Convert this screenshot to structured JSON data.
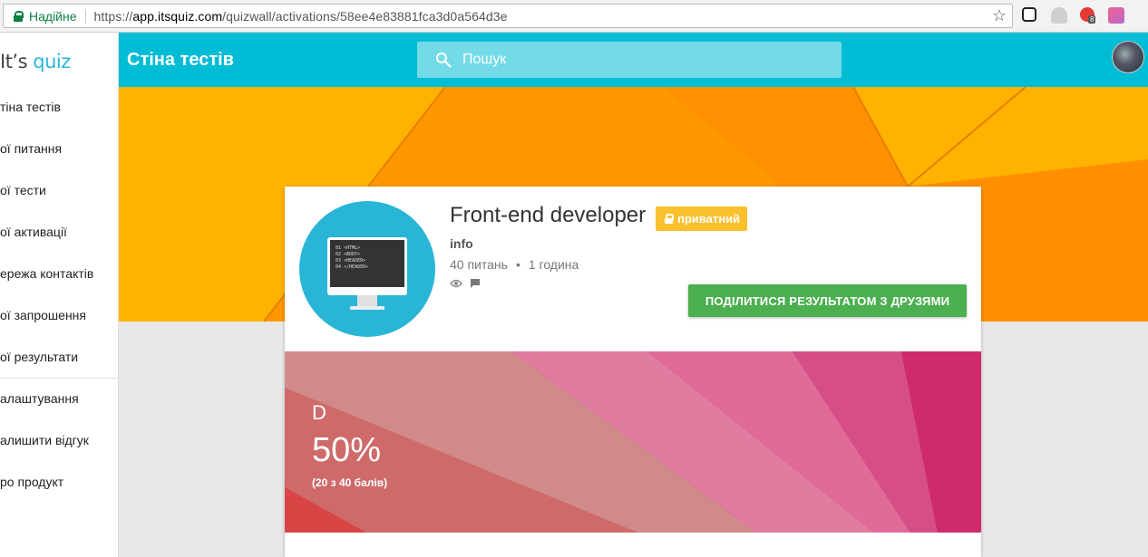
{
  "browser": {
    "secure_label": "Надійне",
    "url_prefix": "https://",
    "url_host": "app.itsquiz.com",
    "url_path": "/quizwall/activations/58ee4e83881fca3d0a564d3e",
    "extension_badge": "8"
  },
  "sidebar": {
    "logo_prefix": "It’s",
    "logo_accent": "quiz",
    "items": [
      {
        "label": "тіна тестів"
      },
      {
        "label": "ої питання"
      },
      {
        "label": "ої тести"
      },
      {
        "label": "ої активації"
      },
      {
        "label": "ережа контактів"
      },
      {
        "label": "ої запрошення"
      },
      {
        "label": "ої результати"
      },
      {
        "label": "алаштування"
      },
      {
        "label": "алишити відгук"
      },
      {
        "label": "ро продукт"
      }
    ]
  },
  "appbar": {
    "title": "Стіна тестів",
    "search_placeholder": "Пошук"
  },
  "quiz": {
    "title": "Front-end developer",
    "badge": "приватний",
    "category": "info",
    "questions": "40 питань",
    "separator": "•",
    "duration": "1 година",
    "share_label": "ПОДІЛИТИСЯ РЕЗУЛЬТАТОМ З ДРУЗЯМИ",
    "code_lines": [
      "01 <HTML>",
      "02 <BODY>",
      "03 <HEADER>",
      "04 </HEADER>"
    ]
  },
  "result": {
    "grade": "D",
    "percent": "50%",
    "points": "(20 з 40 балів)",
    "score_fraction": 0.5
  },
  "colors": {
    "accent": "#00bcd4",
    "badge": "#fbc02d",
    "share_button": "#4caf50",
    "hero_orange": "#ff9800",
    "hero_amber": "#ffb300"
  },
  "icons": [
    "lock-icon",
    "star-icon",
    "search-icon",
    "eye-icon",
    "comment-icon",
    "monitor-icon"
  ]
}
